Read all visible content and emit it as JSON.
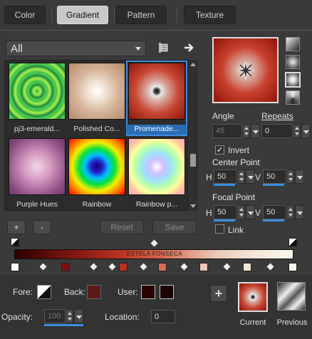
{
  "tabs": [
    {
      "label": "Color"
    },
    {
      "label": "Gradient"
    },
    {
      "label": "Pattern"
    },
    {
      "label": "Texture"
    }
  ],
  "category_select": {
    "value": "All"
  },
  "thumbnails": [
    {
      "label": "pj3-emerald..."
    },
    {
      "label": "Polished Co..."
    },
    {
      "label": "Promenade..."
    },
    {
      "label": "Purple Hues"
    },
    {
      "label": "Rainbow"
    },
    {
      "label": "Rainbow p..."
    }
  ],
  "gallery_buttons": {
    "add": "+",
    "remove": "-",
    "reset": "Reset",
    "save": "Save"
  },
  "angle": {
    "label": "Angle",
    "value": "45"
  },
  "repeats": {
    "label": "Repeats",
    "value": "0"
  },
  "invert": {
    "label": "Invert",
    "checked": true
  },
  "center_point": {
    "label": "Center Point",
    "h_label": "H",
    "h": "50",
    "v_label": "V",
    "v": "50"
  },
  "focal_point": {
    "label": "Focal Point",
    "h_label": "H",
    "h": "50",
    "v_label": "V",
    "v": "50"
  },
  "link": {
    "label": "Link"
  },
  "gradient_bar": {
    "text": "ESTELA FONSECA"
  },
  "fore": {
    "label": "Fore:"
  },
  "back": {
    "label": "Back:"
  },
  "user": {
    "label": "User:"
  },
  "opacity": {
    "label": "Opacity:",
    "value": "100"
  },
  "location": {
    "label": "Location:",
    "value": "0"
  },
  "current": {
    "label": "Current"
  },
  "previous": {
    "label": "Previous"
  },
  "add_button": {
    "label": "+"
  },
  "colors": {
    "accent": "#3a8fe0",
    "background": "#3a3a3a",
    "user_swatch_1": "#2a0404",
    "user_swatch_2": "#1a0202"
  }
}
